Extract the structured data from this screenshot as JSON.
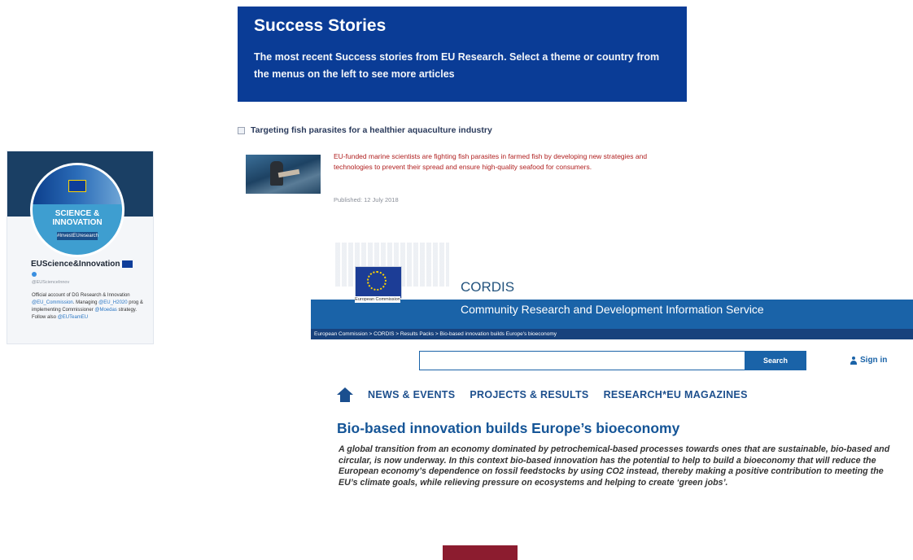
{
  "success_stories": {
    "title": "Success Stories",
    "description": "The most recent Success stories from EU Research. Select a theme or country from the menus on the left to see more articles"
  },
  "article": {
    "title": "Targeting fish parasites for a healthier aquaculture industry",
    "summary": "EU-funded marine scientists are fighting fish parasites in farmed fish by developing new strategies and technologies to prevent their spread and ensure high-quality seafood for consumers.",
    "published": "Published: 12 July 2018"
  },
  "twitter": {
    "avatar_text": "SCIENCE & INNOVATION",
    "avatar_tag": "#InvestEUresearch",
    "name": "EUScience&Innovation",
    "handle": "@EUScienceInnov",
    "bio_1": "Official account of DG Research & Innovation ",
    "bio_link_1": "@EU_Commission",
    "bio_2": ". Managing ",
    "bio_link_2": "@EU_H2020",
    "bio_3": " prog & implementing Commissioner ",
    "bio_link_3": "@Moedas",
    "bio_4": " strategy. Follow also ",
    "bio_link_4": "@EUTeamEU"
  },
  "cordis": {
    "logo_text": "European Commission",
    "name": "CORDIS",
    "subtitle": "Community Research and Development Information Service",
    "breadcrumb": "European Commission  >  CORDIS  >  Results Packs  >  Bio-based innovation builds Europe's bioeconomy",
    "search_placeholder": "",
    "search_button": "Search",
    "sign_in": "Sign in",
    "nav": [
      "NEWS & EVENTS",
      "PROJECTS & RESULTS",
      "RESEARCH*EU MAGAZINES"
    ],
    "article_title": "Bio-based innovation builds Europe’s bioeconomy",
    "article_body": "A global transition from an economy dominated by petrochemical-based processes towards ones that are sustainable, bio-based and circular, is now underway. In this context bio-based innovation has the potential to help to build a bioeconomy that will reduce the European economy’s dependence on fossil feedstocks by using CO2 instead, thereby making a positive contribution to meeting the EU’s climate goals, while relieving pressure on ecosystems and helping to create ‘green jobs’."
  },
  "colors": {
    "banner_blue": "#0a3c96",
    "cordis_blue": "#1a63a8",
    "article_red": "#b02020",
    "accent_red": "#8c1c2f"
  }
}
